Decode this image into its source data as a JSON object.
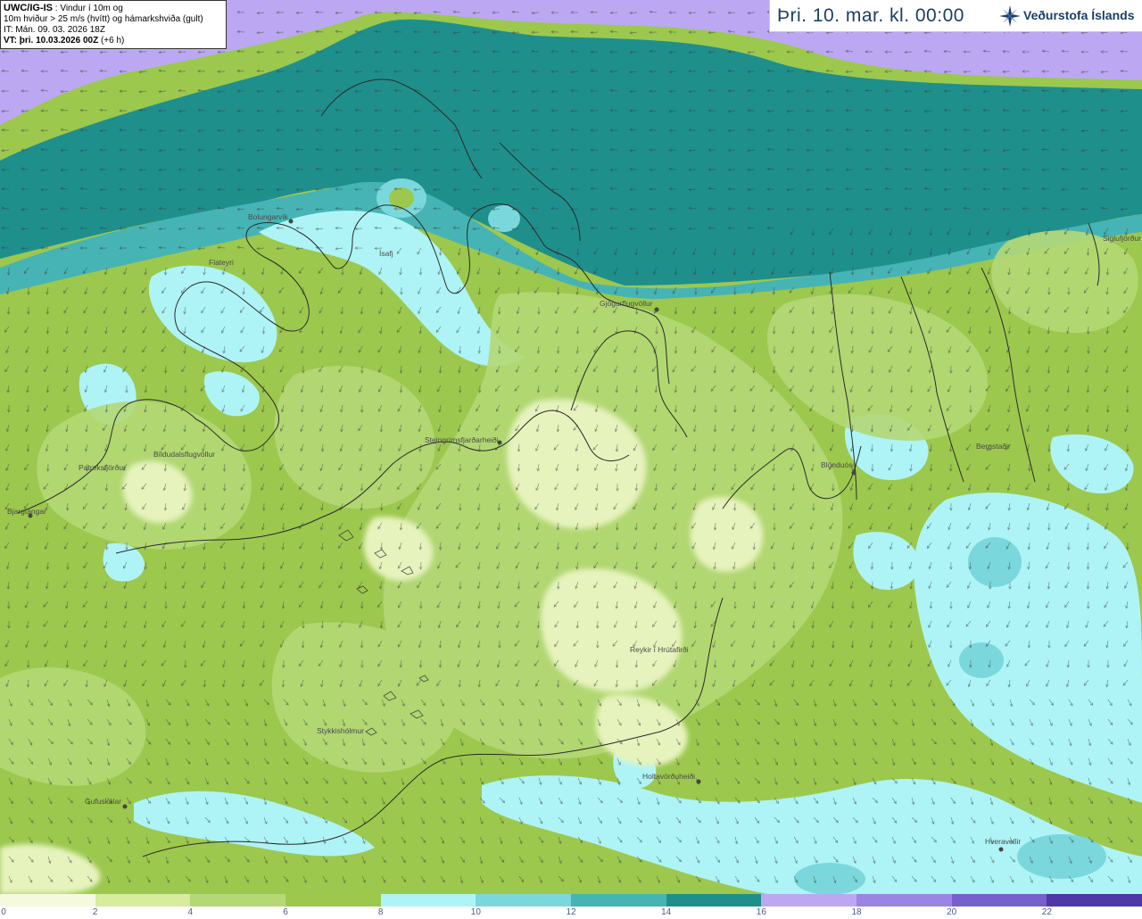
{
  "info": {
    "title": "UWC/IG-IS",
    "title_rest": " : Vindur í 10m og",
    "line2": "10m hviður > 25 m/s (hvítt) og hámarkshviða (gult)",
    "line3": "IT: Mán. 09. 03. 2026 18Z",
    "line4_bold": "VT: þri. 10.03.2026 00Z",
    "line4_rest": " (+6 h)"
  },
  "header": {
    "date": "Þri. 10. mar. kl. 00:00",
    "logo_text": "Veðurstofa Íslands",
    "logo_icon": "vedurstofa-star-logo"
  },
  "places": [
    {
      "name": "Bolungarvík"
    },
    {
      "name": "Flateyri"
    },
    {
      "name": "Ísafj"
    },
    {
      "name": "Gjögurflugvöllur"
    },
    {
      "name": "Siglufjörður"
    },
    {
      "name": "Steingrímsfjarðarheiði"
    },
    {
      "name": "Bíldudalsflugvöllur"
    },
    {
      "name": "Patreksfjörður"
    },
    {
      "name": "Bjargtangar"
    },
    {
      "name": "Blönduós"
    },
    {
      "name": "Bergstaðir"
    },
    {
      "name": "Reykir í Hrútafirði"
    },
    {
      "name": "Stykkishólmur"
    },
    {
      "name": "Holtavörðuheiði"
    },
    {
      "name": "Gufuskálar"
    },
    {
      "name": "Hveravellir"
    }
  ],
  "legend": {
    "unit_scale": [
      "0",
      "2",
      "4",
      "6",
      "8",
      "10",
      "12",
      "14",
      "16",
      "18",
      "20",
      "22"
    ],
    "colors": [
      "#f5fadf",
      "#d8ec9d",
      "#b4d876",
      "#9cc84e",
      "#aef4f6",
      "#7ad8dc",
      "#46b4b4",
      "#1f8f8c",
      "#bca8f2",
      "#9a84e4",
      "#7660cc",
      "#4e38a8"
    ]
  }
}
